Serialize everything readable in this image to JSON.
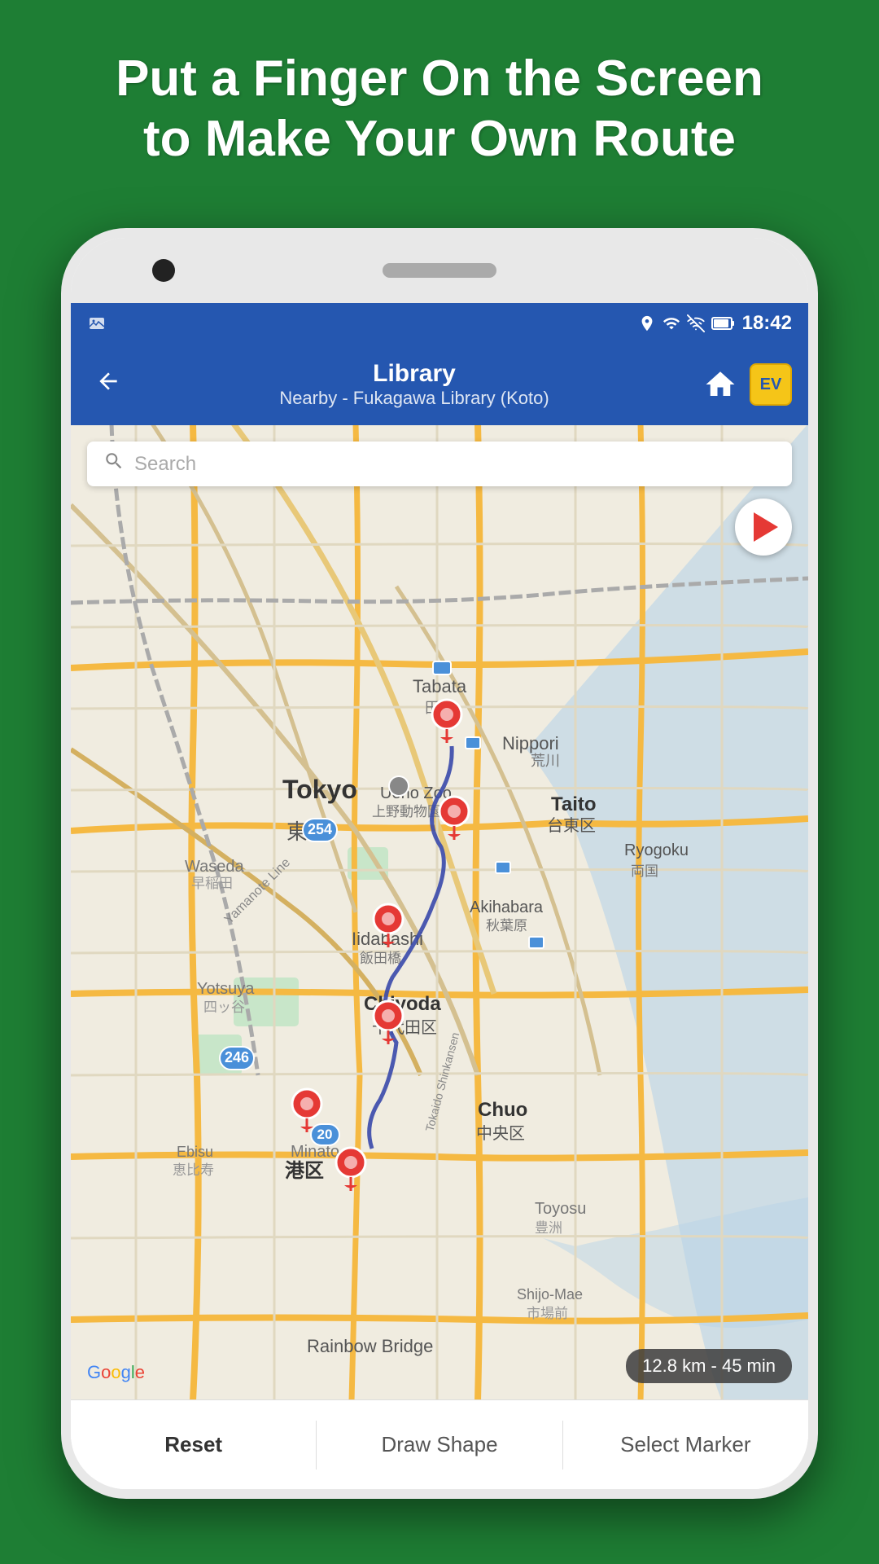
{
  "header": {
    "line1": "Put a Finger On the Screen",
    "line2": "to Make Your Own Route"
  },
  "status_bar": {
    "time": "18:42",
    "icons": [
      "location",
      "wifi",
      "signal",
      "battery"
    ]
  },
  "app_bar": {
    "back_label": "←",
    "title_main": "Library",
    "title_sub": "Nearby - Fukagawa Library (Koto)",
    "home_icon": "home",
    "ev_label": "EV"
  },
  "map": {
    "search_placeholder": "Search",
    "distance_badge": "12.8 km - 45 min",
    "google_text": "Google"
  },
  "bottom_bar": {
    "reset_label": "Reset",
    "draw_shape_label": "Draw Shape",
    "select_marker_label": "Select Marker"
  },
  "markers": [
    {
      "x": 51,
      "y": 33
    },
    {
      "x": 52,
      "y": 43
    },
    {
      "x": 42,
      "y": 54
    },
    {
      "x": 42,
      "y": 65
    },
    {
      "x": 35,
      "y": 73
    },
    {
      "x": 37,
      "y": 79
    }
  ],
  "colors": {
    "bg_green": "#1e7e34",
    "app_bar_blue": "#2557b0",
    "marker_red": "#e53935",
    "route_blue": "#3949ab"
  }
}
